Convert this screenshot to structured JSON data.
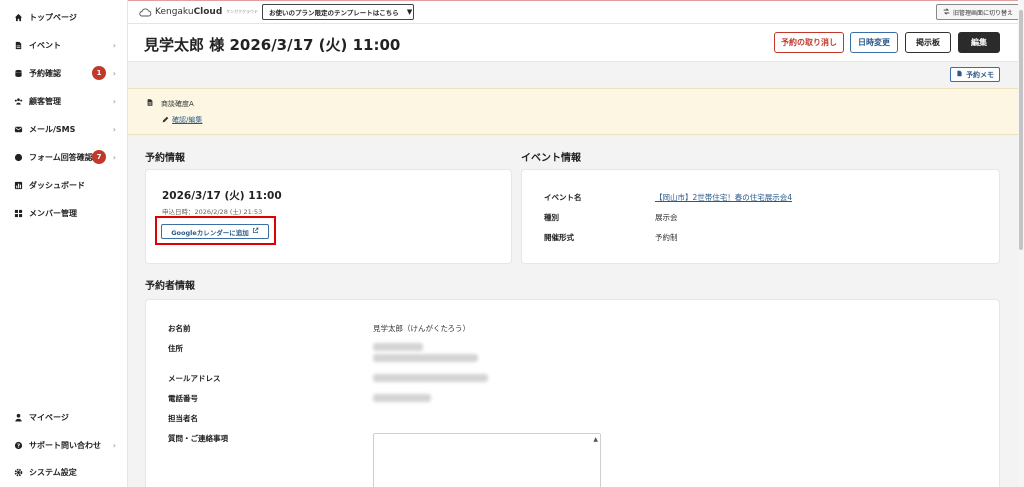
{
  "sidebar": {
    "items": [
      {
        "label": "トップページ",
        "icon": "home-icon",
        "chevron": false
      },
      {
        "label": "イベント",
        "icon": "document-icon",
        "chevron": true
      },
      {
        "label": "予約確認",
        "icon": "database-icon",
        "chevron": true,
        "badge": "1"
      },
      {
        "label": "顧客管理",
        "icon": "users-icon",
        "chevron": true
      },
      {
        "label": "メール/SMS",
        "icon": "mail-icon",
        "chevron": true
      },
      {
        "label": "フォーム回答確認",
        "icon": "chat-bubble-icon",
        "chevron": true,
        "badge": "7"
      },
      {
        "label": "ダッシュボード",
        "icon": "chart-icon",
        "chevron": false
      },
      {
        "label": "メンバー管理",
        "icon": "grid-icon",
        "chevron": false
      }
    ],
    "bottom_items": [
      {
        "label": "マイページ",
        "icon": "person-icon",
        "chevron": false
      },
      {
        "label": "サポート問い合わせ",
        "icon": "question-icon",
        "chevron": true
      },
      {
        "label": "システム設定",
        "icon": "gear-icon",
        "chevron": false
      }
    ],
    "chevron_glyph": "›"
  },
  "topbar": {
    "logo_prefix": "Kengaku",
    "logo_brand": "Cloud",
    "logo_sub": "ケンガククラウド",
    "template_button": "お使いのプラン限定のテンプレートはこちら",
    "template_arrow": "▼",
    "switch_button": "旧管理画面に切り替え"
  },
  "header": {
    "title": "見学太郎 様 2026/3/17 (火) 11:00",
    "buttons": {
      "cancel": "予約の取り消し",
      "change": "日時変更",
      "board": "掲示板",
      "edit": "編集"
    }
  },
  "memo_button": "予約メモ",
  "note": {
    "title": "商談確度A",
    "link": "確認/編集"
  },
  "reservation": {
    "section_title": "予約情報",
    "date": "2026/3/17 (火) 11:00",
    "applied": "申込日時：2026/2/28 (土) 21:53",
    "gcal_button": "Googleカレンダーに追加"
  },
  "event": {
    "section_title": "イベント情報",
    "rows": [
      {
        "label": "イベント名",
        "value": "【岡山市】2世帯住宅！春の住宅展示会4",
        "link": true
      },
      {
        "label": "種別",
        "value": "展示会",
        "link": false
      },
      {
        "label": "開催形式",
        "value": "予約制",
        "link": false
      }
    ]
  },
  "booker": {
    "section_title": "予約者情報",
    "rows": [
      {
        "label": "お名前",
        "value": "見学太郎（けんがくたろう）"
      },
      {
        "label": "住所",
        "value": ""
      },
      {
        "label": "メールアドレス",
        "value": ""
      },
      {
        "label": "電話番号",
        "value": ""
      },
      {
        "label": "担当者名",
        "value": ""
      },
      {
        "label": "質問・ご連絡事項",
        "value": ""
      }
    ]
  },
  "colors": {
    "accent_blue": "#2a5a8a",
    "danger_red": "#c0392b",
    "note_bg": "#fcf6e2",
    "highlight": "#e00000"
  }
}
